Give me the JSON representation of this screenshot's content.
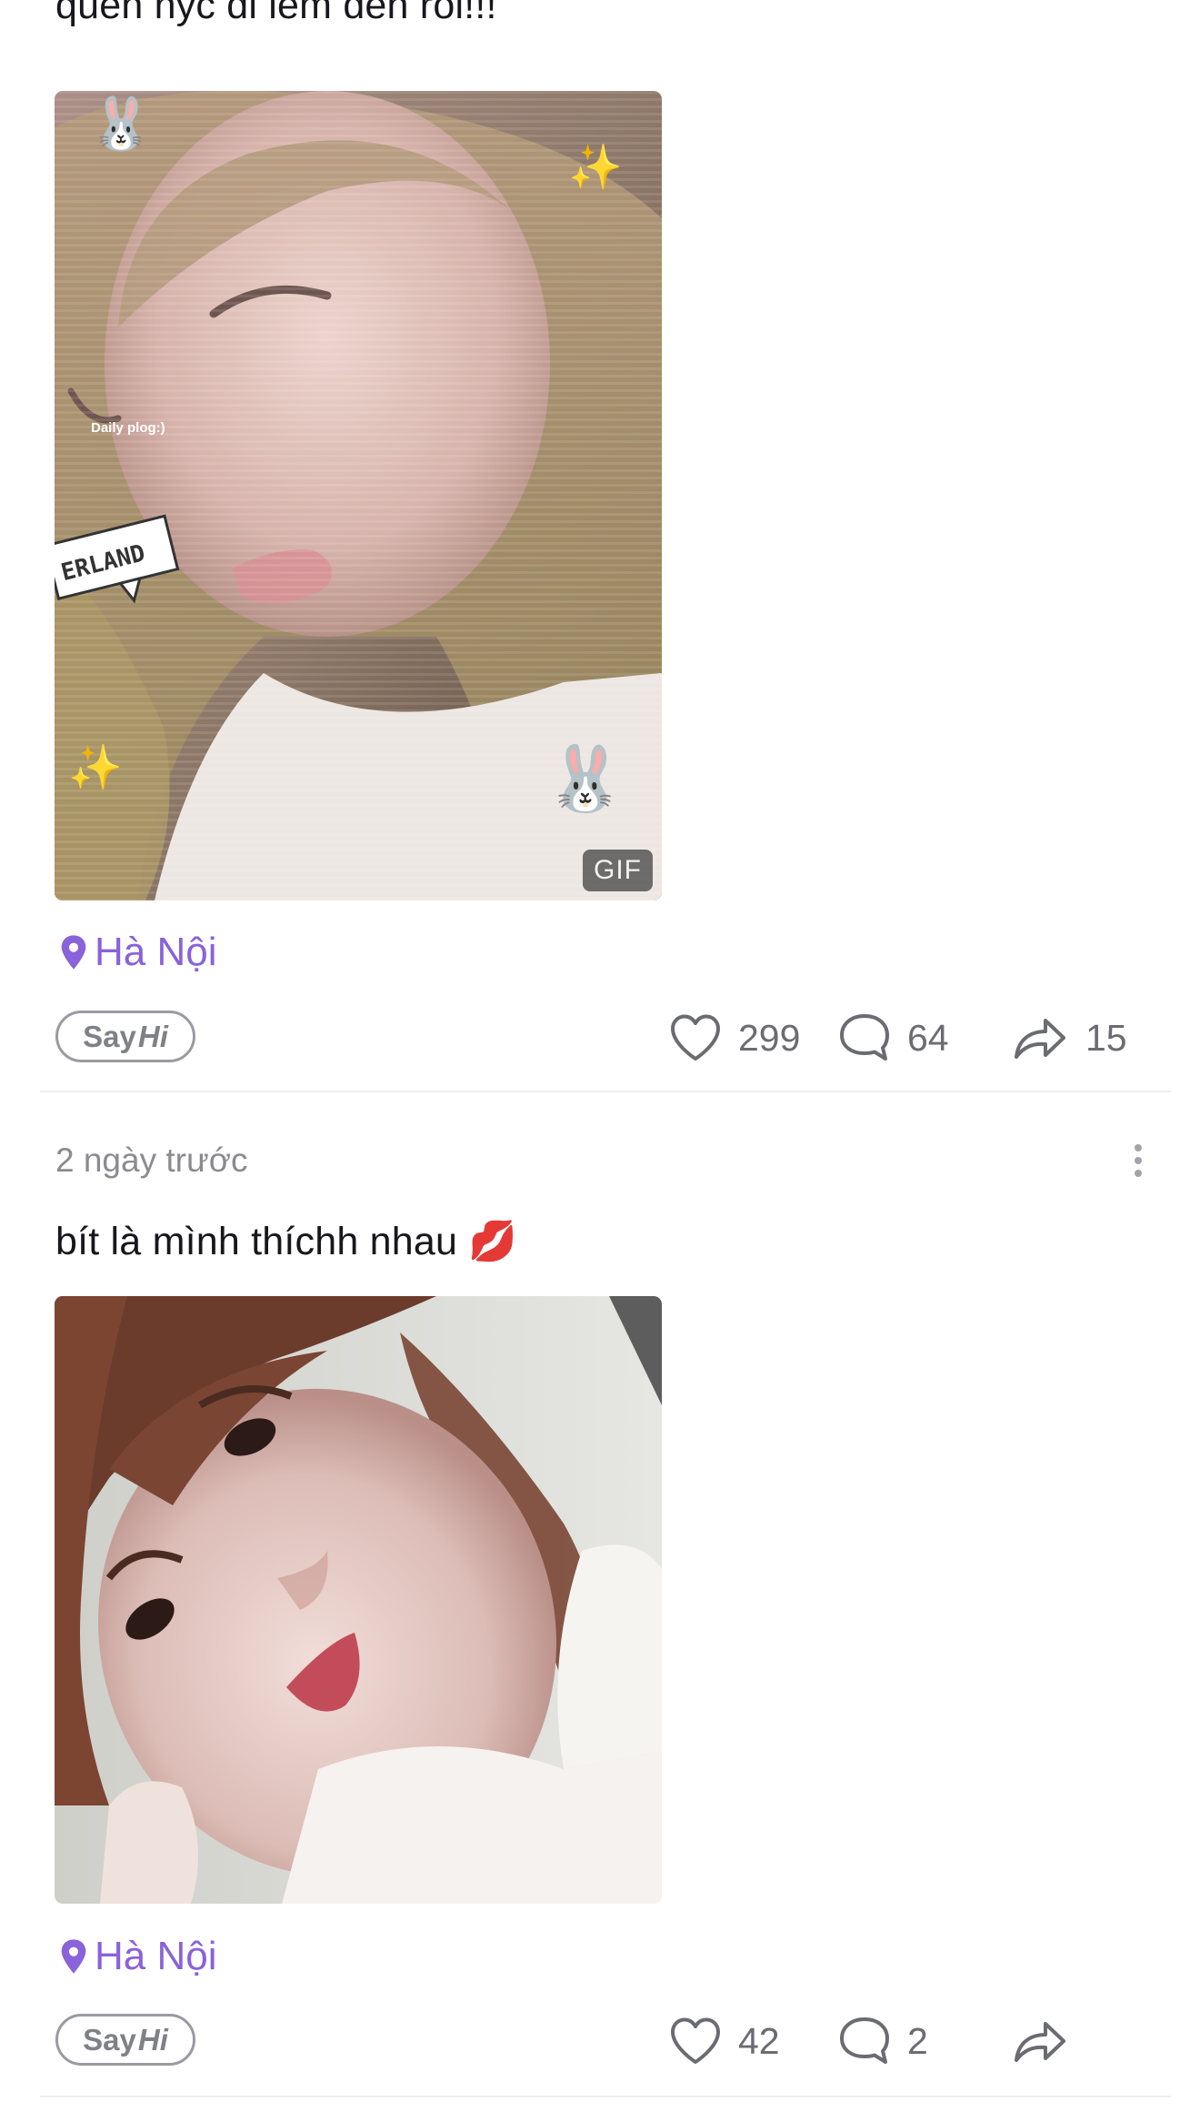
{
  "posts": [
    {
      "caption": "quen nyc di lem den roi!!!",
      "photo_badge": "GIF",
      "photo_overlay_text": "Daily plog:)",
      "photo_sticker_text": "ERLAND",
      "location": "Hà Nội",
      "say_hi": {
        "say": "Say",
        "hi": "Hi"
      },
      "likes": "299",
      "comments": "64",
      "shares": "15"
    },
    {
      "timestamp": "2 ngày trước",
      "caption": "bít là mình thíchh nhau 💋",
      "location": "Hà Nội",
      "say_hi": {
        "say": "Say",
        "hi": "Hi"
      },
      "likes": "42",
      "comments": "2",
      "shares": ""
    }
  ],
  "colors": {
    "accent": "#8a62d9",
    "muted_text": "#8a8a91",
    "icon_stroke": "#6b6b72",
    "divider": "#efeff1"
  },
  "icons": {
    "location": "map-pin-icon",
    "like": "heart-icon",
    "comment": "speech-bubble-icon",
    "share": "share-arrow-icon",
    "more": "more-dots-icon"
  }
}
